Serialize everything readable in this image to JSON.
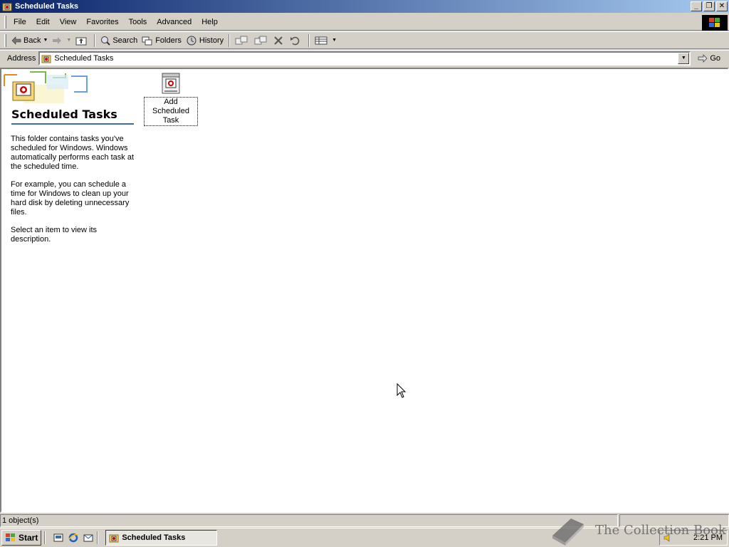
{
  "window": {
    "title": "Scheduled Tasks",
    "controls": [
      "minimize",
      "restore",
      "close"
    ]
  },
  "menubar": {
    "items": [
      "File",
      "Edit",
      "View",
      "Favorites",
      "Tools",
      "Advanced",
      "Help"
    ]
  },
  "toolbar": {
    "back_label": "Back",
    "search_label": "Search",
    "folders_label": "Folders",
    "history_label": "History"
  },
  "addressbar": {
    "label": "Address",
    "value": "Scheduled Tasks",
    "go_label": "Go"
  },
  "webview": {
    "title": "Scheduled Tasks",
    "paragraphs": [
      "This folder contains tasks you've scheduled for Windows. Windows automatically performs each task at the scheduled time.",
      "For example, you can schedule a time for Windows to clean up your hard disk by deleting unnecessary files.",
      "Select an item to view its description."
    ]
  },
  "items": [
    {
      "label": "Add Scheduled Task",
      "icon": "add-task-icon"
    }
  ],
  "statusbar": {
    "text": "1 object(s)"
  },
  "taskbar": {
    "start_label": "Start",
    "active_task": "Scheduled Tasks",
    "clock": "2:21 PM"
  },
  "watermark": {
    "text": "The Collection Book"
  },
  "colors": {
    "titlebar_start": "#0a246a",
    "titlebar_end": "#a6caf0",
    "face": "#d4d0c8",
    "webview_rule": "#3a6ea5"
  }
}
